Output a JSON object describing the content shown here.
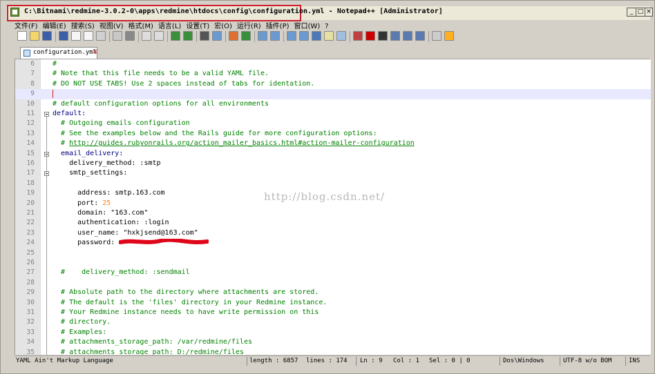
{
  "window": {
    "title": "C:\\Bitnami\\redmine-3.0.2-0\\apps\\redmine\\htdocs\\config\\configuration.yml - Notepad++ [Administrator]"
  },
  "menu": [
    "文件(F)",
    "编辑(E)",
    "搜索(S)",
    "视图(V)",
    "格式(M)",
    "语言(L)",
    "设置(T)",
    "宏(O)",
    "运行(R)",
    "插件(P)",
    "窗口(W)",
    "?"
  ],
  "tab": {
    "label": "configuration.yml"
  },
  "watermark": "http://blog.csdn.net/",
  "editor": {
    "lines": [
      {
        "n": "6",
        "text": "#",
        "kind": "comment"
      },
      {
        "n": "7",
        "text": "# Note that this file needs to be a valid YAML file.",
        "kind": "comment"
      },
      {
        "n": "8",
        "text": "# DO NOT USE TABS! Use 2 spaces instead of tabs for identation.",
        "kind": "comment"
      },
      {
        "n": "9",
        "text": "",
        "kind": "current"
      },
      {
        "n": "10",
        "text": "# default configuration options for all environments",
        "kind": "comment"
      },
      {
        "n": "11",
        "text": "default:",
        "kind": "key"
      },
      {
        "n": "12",
        "text": "  # Outgoing emails configuration",
        "kind": "comment"
      },
      {
        "n": "13",
        "text": "  # See the examples below and the Rails guide for more configuration options:",
        "kind": "comment"
      },
      {
        "n": "14",
        "text": "  # http://guides.rubyonrails.org/action_mailer_basics.html#action-mailer-configuration",
        "kind": "comment"
      },
      {
        "n": "15",
        "text": "  email_delivery:",
        "kind": "key"
      },
      {
        "n": "16",
        "text": "    delivery_method: :smtp",
        "kind": "plain"
      },
      {
        "n": "17",
        "text": "    smtp_settings:",
        "kind": "plain"
      },
      {
        "n": "18",
        "text": "",
        "kind": "plain"
      },
      {
        "n": "19",
        "text": "      address: smtp.163.com",
        "kind": "plain"
      },
      {
        "n": "20",
        "text": "      port: 25",
        "kind": "port"
      },
      {
        "n": "21",
        "text": "      domain: \"163.com\"",
        "kind": "plain"
      },
      {
        "n": "22",
        "text": "      authentication: :login",
        "kind": "plain"
      },
      {
        "n": "23",
        "text": "      user_name: \"hxkjsend@163.com\"",
        "kind": "plain"
      },
      {
        "n": "24",
        "text": "      password:",
        "kind": "plain"
      },
      {
        "n": "25",
        "text": "",
        "kind": "plain"
      },
      {
        "n": "26",
        "text": "",
        "kind": "plain"
      },
      {
        "n": "27",
        "text": "  #    delivery_method: :sendmail",
        "kind": "comment"
      },
      {
        "n": "28",
        "text": "",
        "kind": "plain"
      },
      {
        "n": "29",
        "text": "  # Absolute path to the directory where attachments are stored.",
        "kind": "comment"
      },
      {
        "n": "30",
        "text": "  # The default is the 'files' directory in your Redmine instance.",
        "kind": "comment"
      },
      {
        "n": "31",
        "text": "  # Your Redmine instance needs to have write permission on this",
        "kind": "comment"
      },
      {
        "n": "32",
        "text": "  # directory.",
        "kind": "comment"
      },
      {
        "n": "33",
        "text": "  # Examples:",
        "kind": "comment"
      },
      {
        "n": "34",
        "text": "  # attachments_storage_path: /var/redmine/files",
        "kind": "comment"
      },
      {
        "n": "35",
        "text": "  # attachments_storage_path: D:/redmine/files",
        "kind": "comment"
      }
    ]
  },
  "status": {
    "file_type": "YAML Ain't Markup Language",
    "length": "length : 6857",
    "lines": "lines : 174",
    "ln": "Ln : 9",
    "col": "Col : 1",
    "sel": "Sel : 0 | 0",
    "eol": "Dos\\Windows",
    "encoding": "UTF-8 w/o BOM",
    "mode": "INS"
  }
}
